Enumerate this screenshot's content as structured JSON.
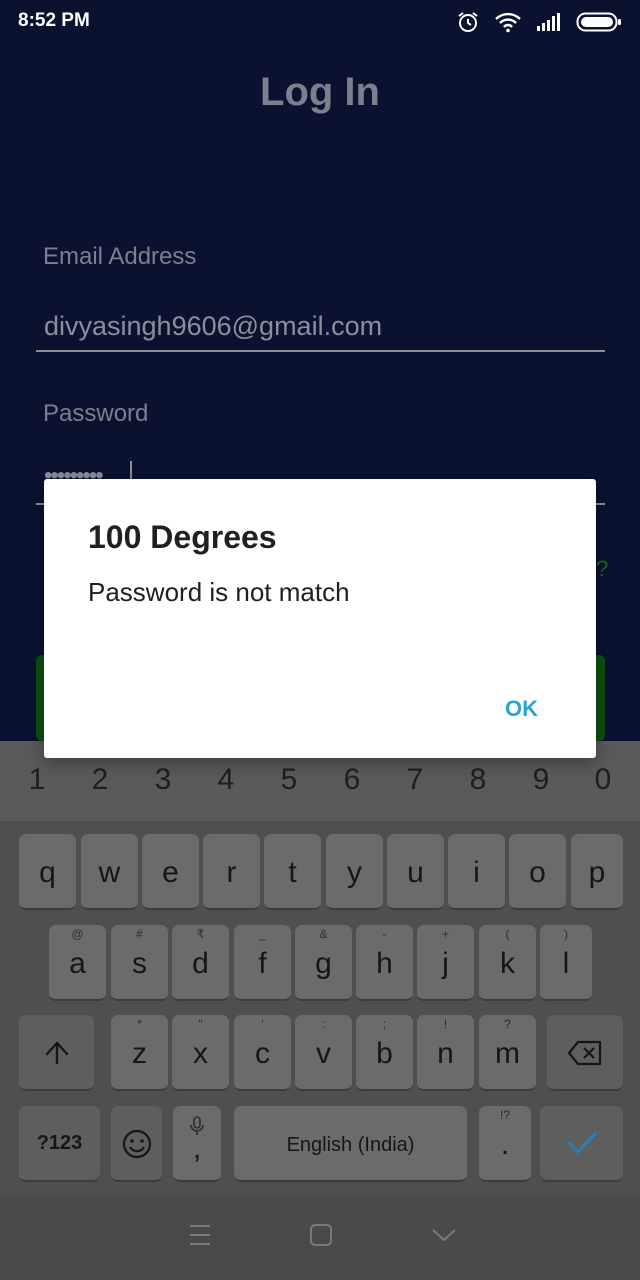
{
  "status_bar": {
    "time": "8:52 PM",
    "icons": [
      "alarm-icon",
      "wifi-icon",
      "signal-icon",
      "battery-icon"
    ]
  },
  "screen": {
    "title": "Log In",
    "email_label": "Email Address",
    "email_value": "divyasingh9606@gmail.com",
    "password_label": "Password",
    "password_value": "•••••••••",
    "forgot_partial": "?"
  },
  "dialog": {
    "title": "100 Degrees",
    "message": "Password is not match",
    "ok_label": "OK"
  },
  "keyboard": {
    "number_row": [
      "1",
      "2",
      "3",
      "4",
      "5",
      "6",
      "7",
      "8",
      "9",
      "0"
    ],
    "row1": [
      "q",
      "w",
      "e",
      "r",
      "t",
      "y",
      "u",
      "i",
      "o",
      "p"
    ],
    "row2": [
      "a",
      "s",
      "d",
      "f",
      "g",
      "h",
      "j",
      "k",
      "l"
    ],
    "row2_hints": [
      "@",
      "#",
      "₹",
      "_",
      "&",
      "-",
      "+",
      "(",
      ")"
    ],
    "row3": [
      "z",
      "x",
      "c",
      "v",
      "b",
      "n",
      "m"
    ],
    "row3_hints": [
      "*",
      "\"",
      "'",
      ":",
      ";",
      "!",
      "?"
    ],
    "symbols_label": "?123",
    "comma_label": ",",
    "space_label": "English (India)",
    "period_label": ".",
    "period_hint": "!?",
    "icons": [
      "shift-icon",
      "backspace-icon",
      "emoji-icon",
      "mic-icon",
      "done-check-icon"
    ]
  },
  "nav_bar": {
    "icons": [
      "menu-icon",
      "home-icon",
      "back-chevron-icon"
    ]
  },
  "colors": {
    "background": "#0a1230",
    "accent": "#2aa3d8",
    "button_green": "#0f5010"
  }
}
